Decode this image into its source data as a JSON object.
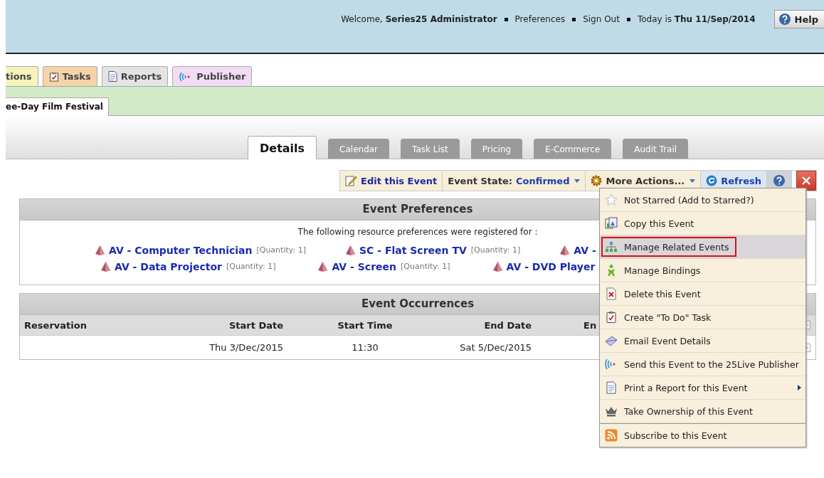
{
  "header": {
    "welcome_label": "Welcome,",
    "user": "Series25 Administrator",
    "links": [
      "Preferences",
      "Sign Out"
    ],
    "today_label": "Today is",
    "today": "Thu 11/Sep/2014",
    "help": "Help"
  },
  "nav_tabs": [
    {
      "label": "tions",
      "kind": "plain",
      "color": "#f7f3bd",
      "selected": false
    },
    {
      "label": "Tasks",
      "kind": "task",
      "color": "#f6d4a8",
      "selected": false
    },
    {
      "label": "Reports",
      "kind": "report",
      "color": "#e4e4e4",
      "selected": false
    },
    {
      "label": "Publisher",
      "kind": "publisher",
      "color": "#f1dcf3",
      "selected": false
    }
  ],
  "event_tabs": [
    {
      "label": "ee-Day Film Festival",
      "selected": true
    }
  ],
  "detail_tabs": [
    {
      "label": "Details",
      "selected": true
    },
    {
      "label": "Calendar",
      "selected": false
    },
    {
      "label": "Task List",
      "selected": false
    },
    {
      "label": "Pricing",
      "selected": false
    },
    {
      "label": "E-Commerce",
      "selected": false
    },
    {
      "label": "Audit Trail",
      "selected": false
    }
  ],
  "toolbar": {
    "edit": "Edit this Event",
    "state_label": "Event State:",
    "state_value": "Confirmed",
    "more": "More Actions...",
    "refresh": "Refresh"
  },
  "preferences": {
    "title": "Event Preferences",
    "intro": "The following resource preferences were registered for :",
    "items": [
      {
        "name": "AV - Computer Technician",
        "quantity": "[Quantity: 1]"
      },
      {
        "name": "SC - Flat Screen TV",
        "quantity": "[Quantity: 1]"
      },
      {
        "name": "AV -"
      },
      {
        "name": "AV - Data Projector",
        "quantity": "[Quantity: 1]"
      },
      {
        "name": "AV - Screen",
        "quantity": "[Quantity: 1]"
      },
      {
        "name": "AV - DVD Player"
      }
    ]
  },
  "occurrences": {
    "title": "Event Occurrences",
    "columns": [
      "Reservation",
      "Start Date",
      "Start Time",
      "End Date",
      "En"
    ],
    "rows": [
      {
        "start_date": "Thu 3/Dec/2015",
        "start_time": "11:30",
        "end_date": "Sat 5/Dec/2015"
      }
    ]
  },
  "menu": {
    "items": [
      {
        "kind": "star",
        "label": "Not Starred (Add to Starred?)",
        "selected": false,
        "submenu": false
      },
      {
        "kind": "copy",
        "label": "Copy this Event",
        "selected": false,
        "submenu": false
      },
      {
        "kind": "related",
        "label": "Manage Related Events",
        "selected": true,
        "submenu": false
      },
      {
        "kind": "bindings",
        "label": "Manage Bindings",
        "selected": false,
        "submenu": false
      },
      {
        "kind": "delete",
        "label": "Delete this Event",
        "selected": false,
        "submenu": false
      },
      {
        "kind": "todo",
        "label": "Create \"To Do\" Task",
        "selected": false,
        "submenu": false
      },
      {
        "kind": "email",
        "label": "Email Event Details",
        "selected": false,
        "submenu": false
      },
      {
        "kind": "publisher",
        "label": "Send this Event to the 25Live Publisher",
        "selected": false,
        "submenu": false
      },
      {
        "kind": "report",
        "label": "Print a Report for this Event",
        "selected": false,
        "submenu": true
      },
      {
        "kind": "ownership",
        "label": "Take Ownership of this Event",
        "selected": false,
        "submenu": false
      },
      {
        "kind": "rss",
        "label": "Subscribe to this Event",
        "selected": false,
        "submenu": false
      }
    ]
  }
}
